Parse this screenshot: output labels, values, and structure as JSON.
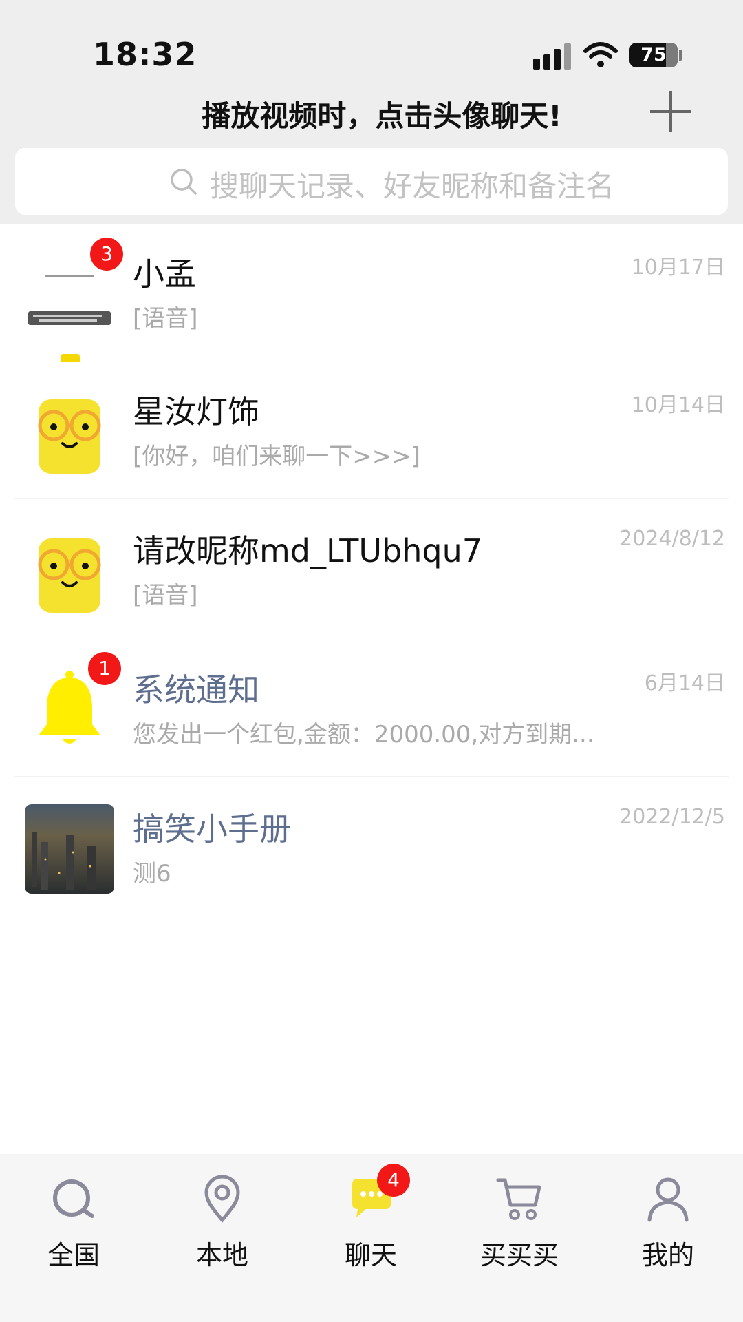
{
  "status_bar": {
    "time": "18:32",
    "battery": "75"
  },
  "header": {
    "title": "播放视频时，点击头像聊天!",
    "add_icon": "plus-icon"
  },
  "search": {
    "placeholder": "搜聊天记录、好友昵称和备注名"
  },
  "chats": [
    {
      "name": "小孟",
      "preview": "[语音]",
      "date": "10月17日",
      "badge": "3",
      "avatar": "screenshot-thumbnail"
    },
    {
      "name": "星汝灯饰",
      "preview": "[你好，咱们来聊一下>>>]",
      "date": "10月14日",
      "avatar": "yellow-glasses-face"
    },
    {
      "name": "请改昵称md_LTUbhqu7",
      "preview": "[语音]",
      "date": "2024/8/12",
      "avatar": "yellow-glasses-face"
    },
    {
      "name": "系统通知",
      "preview": "您发出一个红包,金额：2000.00,对方到期...",
      "date": "6月14日",
      "badge": "1",
      "avatar": "bell-icon"
    },
    {
      "name": "搞笑小手册",
      "preview": "测6",
      "date": "2022/12/5",
      "avatar": "city-photo"
    }
  ],
  "tabbar": {
    "tabs": [
      {
        "label": "全国",
        "icon": "search-icon"
      },
      {
        "label": "本地",
        "icon": "location-pin-icon"
      },
      {
        "label": "聊天",
        "icon": "chat-bubble-icon",
        "badge": "4",
        "active": true
      },
      {
        "label": "买买买",
        "icon": "cart-icon"
      },
      {
        "label": "我的",
        "icon": "person-icon"
      }
    ]
  },
  "colors": {
    "accent_yellow": "#f5e22e",
    "badge_red": "#f21818",
    "name_blue": "#5e6e8f"
  }
}
